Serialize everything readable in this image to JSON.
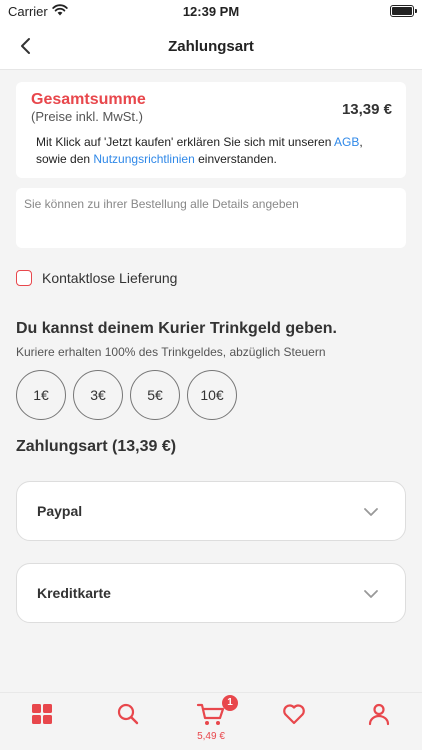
{
  "status_bar": {
    "carrier": "Carrier",
    "time": "12:39 PM"
  },
  "header": {
    "title": "Zahlungsart"
  },
  "total": {
    "label": "Gesamtsumme",
    "subtitle": "(Preise inkl. MwSt.)",
    "amount": "13,39 €",
    "legal_prefix": "Mit Klick auf 'Jetzt kaufen' erklären Sie sich mit unseren ",
    "legal_link_agb": "AGB",
    "legal_middle": ",\nsowie den ",
    "legal_link_terms": "Nutzungsrichtlinien",
    "legal_suffix": " einverstanden."
  },
  "notes": {
    "placeholder": "Sie können zu ihrer Bestellung alle Details angeben"
  },
  "contactless": {
    "label": "Kontaktlose Lieferung"
  },
  "tip": {
    "title": "Du kannst deinem Kurier Trinkgeld geben.",
    "subtitle": "Kuriere erhalten 100% des Trinkgeldes, abzüglich Steuern",
    "options": [
      "1€",
      "3€",
      "5€",
      "10€"
    ]
  },
  "payment": {
    "title": "Zahlungsart (13,39 €)",
    "methods": [
      "Paypal",
      "Kreditkarte"
    ]
  },
  "tabbar": {
    "cart_badge": "1",
    "cart_price": "5,49 €"
  },
  "colors": {
    "accent": "#e8474c",
    "link": "#2f88e8"
  }
}
